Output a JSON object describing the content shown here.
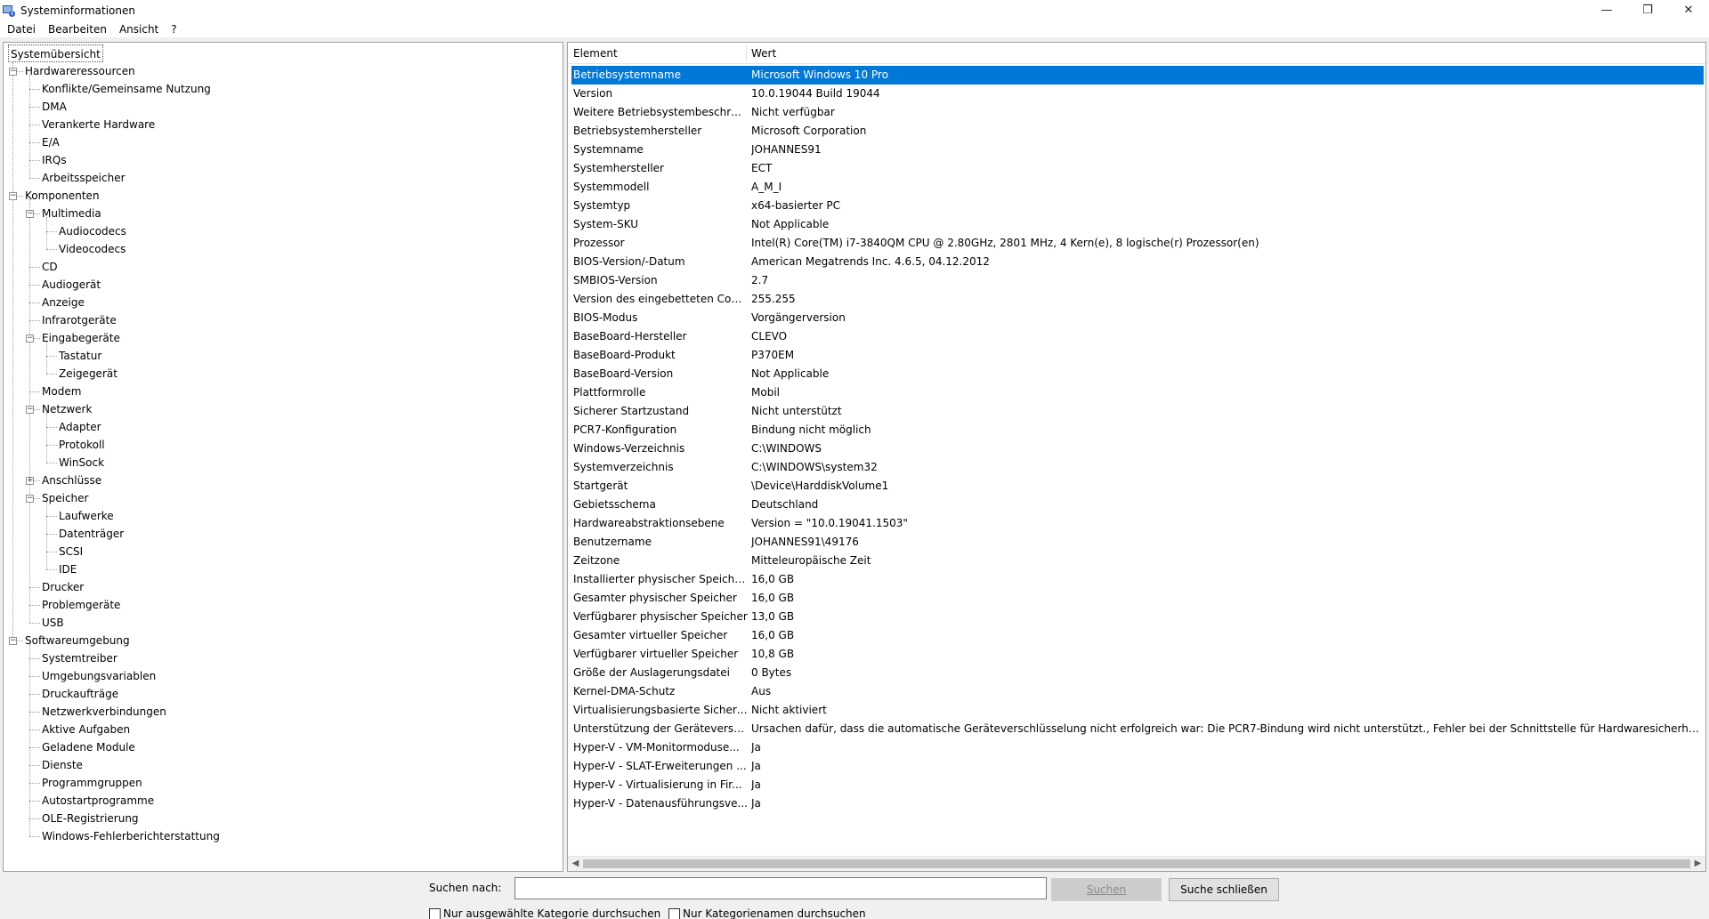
{
  "window": {
    "title": "Systeminformationen",
    "minimize_glyph": "—",
    "restore_glyph": "❐",
    "close_glyph": "✕"
  },
  "menu": [
    "Datei",
    "Bearbeiten",
    "Ansicht",
    "?"
  ],
  "tree": {
    "root": "Systemübersicht",
    "items": [
      {
        "label": "Hardwareressourcen",
        "level": 1,
        "expander": "−"
      },
      {
        "label": "Konflikte/Gemeinsame Nutzung",
        "level": 2
      },
      {
        "label": "DMA",
        "level": 2
      },
      {
        "label": "Verankerte Hardware",
        "level": 2
      },
      {
        "label": "E/A",
        "level": 2
      },
      {
        "label": "IRQs",
        "level": 2
      },
      {
        "label": "Arbeitsspeicher",
        "level": 2
      },
      {
        "label": "Komponenten",
        "level": 1,
        "expander": "−"
      },
      {
        "label": "Multimedia",
        "level": 2,
        "expander": "−"
      },
      {
        "label": "Audiocodecs",
        "level": 3
      },
      {
        "label": "Videocodecs",
        "level": 3
      },
      {
        "label": "CD",
        "level": 2
      },
      {
        "label": "Audiogerät",
        "level": 2
      },
      {
        "label": "Anzeige",
        "level": 2
      },
      {
        "label": "Infrarotgeräte",
        "level": 2
      },
      {
        "label": "Eingabegeräte",
        "level": 2,
        "expander": "−"
      },
      {
        "label": "Tastatur",
        "level": 3
      },
      {
        "label": "Zeigegerät",
        "level": 3
      },
      {
        "label": "Modem",
        "level": 2
      },
      {
        "label": "Netzwerk",
        "level": 2,
        "expander": "−"
      },
      {
        "label": "Adapter",
        "level": 3
      },
      {
        "label": "Protokoll",
        "level": 3
      },
      {
        "label": "WinSock",
        "level": 3
      },
      {
        "label": "Anschlüsse",
        "level": 2,
        "expander": "+"
      },
      {
        "label": "Speicher",
        "level": 2,
        "expander": "−"
      },
      {
        "label": "Laufwerke",
        "level": 3
      },
      {
        "label": "Datenträger",
        "level": 3
      },
      {
        "label": "SCSI",
        "level": 3
      },
      {
        "label": "IDE",
        "level": 3
      },
      {
        "label": "Drucker",
        "level": 2
      },
      {
        "label": "Problemgeräte",
        "level": 2
      },
      {
        "label": "USB",
        "level": 2
      },
      {
        "label": "Softwareumgebung",
        "level": 1,
        "expander": "−"
      },
      {
        "label": "Systemtreiber",
        "level": 2
      },
      {
        "label": "Umgebungsvariablen",
        "level": 2
      },
      {
        "label": "Druckaufträge",
        "level": 2
      },
      {
        "label": "Netzwerkverbindungen",
        "level": 2
      },
      {
        "label": "Aktive Aufgaben",
        "level": 2
      },
      {
        "label": "Geladene Module",
        "level": 2
      },
      {
        "label": "Dienste",
        "level": 2
      },
      {
        "label": "Programmgruppen",
        "level": 2
      },
      {
        "label": "Autostartprogramme",
        "level": 2
      },
      {
        "label": "OLE-Registrierung",
        "level": 2
      },
      {
        "label": "Windows-Fehlerberichterstattung",
        "level": 2
      }
    ]
  },
  "list": {
    "columns": [
      "Element",
      "Wert"
    ],
    "rows": [
      [
        "Betriebsystemname",
        "Microsoft Windows 10 Pro"
      ],
      [
        "Version",
        "10.0.19044 Build 19044"
      ],
      [
        "Weitere Betriebsystembeschrei...",
        "Nicht verfügbar"
      ],
      [
        "Betriebsystemhersteller",
        "Microsoft Corporation"
      ],
      [
        "Systemname",
        "JOHANNES91"
      ],
      [
        "Systemhersteller",
        "ECT"
      ],
      [
        "Systemmodell",
        "A_M_I"
      ],
      [
        "Systemtyp",
        "x64-basierter PC"
      ],
      [
        "System-SKU",
        "Not Applicable"
      ],
      [
        "Prozessor",
        "Intel(R) Core(TM) i7-3840QM CPU @ 2.80GHz, 2801 MHz, 4 Kern(e), 8 logische(r) Prozessor(en)"
      ],
      [
        "BIOS-Version/-Datum",
        "American Megatrends Inc. 4.6.5, 04.12.2012"
      ],
      [
        "SMBIOS-Version",
        "2.7"
      ],
      [
        "Version des eingebetteten Cont...",
        "255.255"
      ],
      [
        "BIOS-Modus",
        "Vorgängerversion"
      ],
      [
        "BaseBoard-Hersteller",
        "CLEVO"
      ],
      [
        "BaseBoard-Produkt",
        "P370EM"
      ],
      [
        "BaseBoard-Version",
        "Not Applicable"
      ],
      [
        "Plattformrolle",
        "Mobil"
      ],
      [
        "Sicherer Startzustand",
        "Nicht unterstützt"
      ],
      [
        "PCR7-Konfiguration",
        "Bindung nicht möglich"
      ],
      [
        "Windows-Verzeichnis",
        "C:\\WINDOWS"
      ],
      [
        "Systemverzeichnis",
        "C:\\WINDOWS\\system32"
      ],
      [
        "Startgerät",
        "\\Device\\HarddiskVolume1"
      ],
      [
        "Gebietsschema",
        "Deutschland"
      ],
      [
        "Hardwareabstraktionsebene",
        "Version = \"10.0.19041.1503\""
      ],
      [
        "Benutzername",
        "JOHANNES91\\49176"
      ],
      [
        "Zeitzone",
        "Mitteleuropäische Zeit"
      ],
      [
        "Installierter physischer Speicher...",
        "16,0 GB"
      ],
      [
        "Gesamter physischer Speicher",
        "16,0 GB"
      ],
      [
        "Verfügbarer physischer Speicher",
        "13,0 GB"
      ],
      [
        "Gesamter virtueller Speicher",
        "16,0 GB"
      ],
      [
        "Verfügbarer virtueller Speicher",
        "10,8 GB"
      ],
      [
        "Größe der Auslagerungsdatei",
        "0 Bytes"
      ],
      [
        "Kernel-DMA-Schutz",
        "Aus"
      ],
      [
        "Virtualisierungsbasierte Sicherh...",
        "Nicht aktiviert"
      ],
      [
        "Unterstützung der Geräteversc...",
        "Ursachen dafür, dass die automatische Geräteverschlüsselung nicht erfolgreich war: Die PCR7-Bindung wird nicht unterstützt., Fehler bei der Schnittstelle für Hardwaresicherheitstests..."
      ],
      [
        "Hyper-V - VM-Monitormoduse...",
        "Ja"
      ],
      [
        "Hyper-V - SLAT-Erweiterungen ...",
        "Ja"
      ],
      [
        "Hyper-V - Virtualisierung in Fir...",
        "Ja"
      ],
      [
        "Hyper-V - Datenausführungsve...",
        "Ja"
      ]
    ],
    "selected_index": 0
  },
  "search": {
    "label": "Suchen nach:",
    "value": "",
    "search_button": "Suchen",
    "close_button": "Suche schließen",
    "checkbox_selected_category": "Nur ausgewählte Kategorie durchsuchen",
    "checkbox_category_names": "Nur Kategorienamen durchsuchen"
  }
}
